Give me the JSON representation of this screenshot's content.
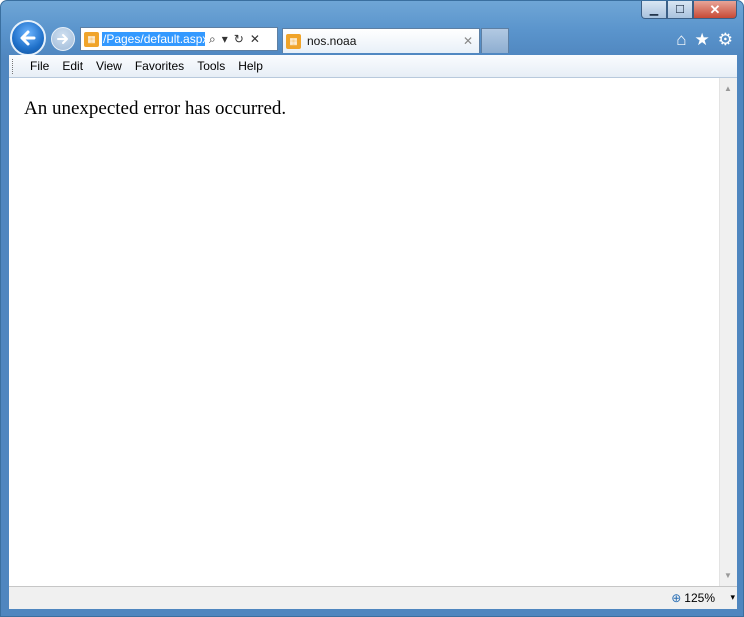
{
  "window": {
    "caption": {
      "minimize": "▁",
      "maximize": "☐",
      "close": "✕"
    }
  },
  "nav": {
    "back_icon": "←",
    "forward_icon": "→"
  },
  "address_bar": {
    "url": "/Pages/default.aspx",
    "icons": {
      "search": "⌕",
      "dropdown": "▾",
      "refresh": "↻",
      "stop": "✕"
    }
  },
  "tab": {
    "title": "nos.noaa",
    "close": "✕"
  },
  "toolbar_right": {
    "home": "⌂",
    "favorites": "★",
    "tools": "⚙"
  },
  "menu": {
    "items": [
      {
        "label": "File"
      },
      {
        "label": "Edit"
      },
      {
        "label": "View"
      },
      {
        "label": "Favorites"
      },
      {
        "label": "Tools"
      },
      {
        "label": "Help"
      }
    ]
  },
  "content": {
    "message": "An unexpected error has occurred."
  },
  "status": {
    "zoom": "125%",
    "zoom_icon": "⊕",
    "dropdown": "▾"
  },
  "colors": {
    "frame": "#5a94cc",
    "selection": "#3399ff",
    "favicon": "#f0a42a"
  }
}
